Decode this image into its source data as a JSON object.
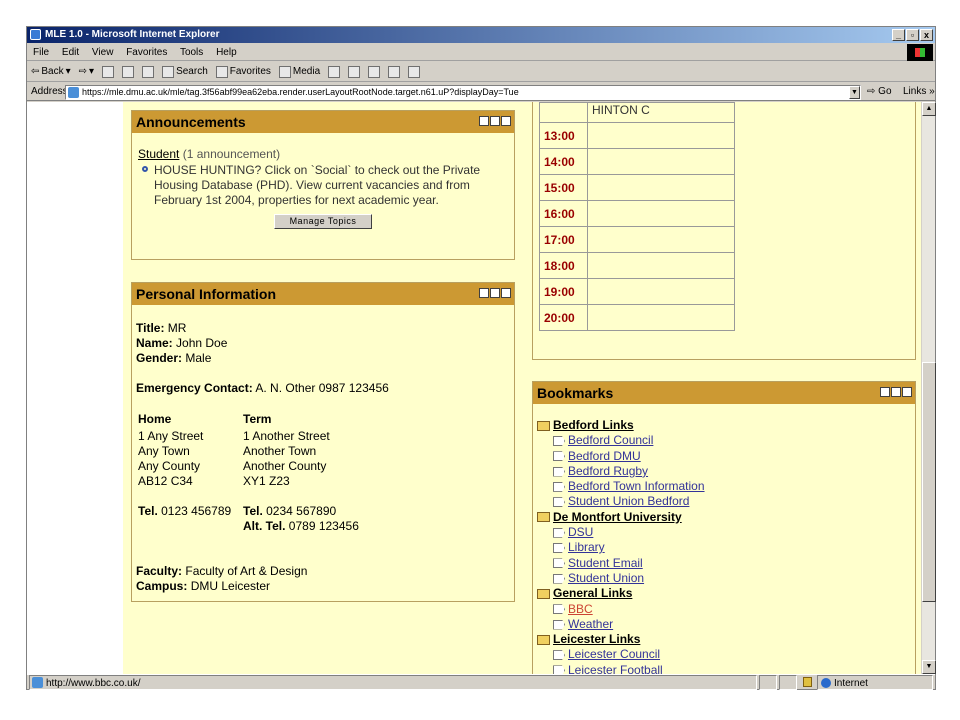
{
  "window": {
    "title": "MLE 1.0 - Microsoft Internet Explorer",
    "controls": [
      "_",
      "▫",
      "x"
    ]
  },
  "menu": [
    "File",
    "Edit",
    "View",
    "Favorites",
    "Tools",
    "Help"
  ],
  "toolbar": {
    "back": "Back",
    "search": "Search",
    "favorites": "Favorites",
    "media": "Media"
  },
  "address": {
    "label": "Address",
    "url": "https://mle.dmu.ac.uk/mle/tag.3f56abf99ea62eba.render.userLayoutRootNode.target.n61.uP?displayDay=Tue",
    "go": "Go",
    "links": "Links"
  },
  "announcements": {
    "title": "Announcements",
    "topic": "Student",
    "count": "(1 announcement)",
    "item": "HOUSE HUNTING? Click on `Social` to check out the Private Housing Database (PHD). View current vacancies and from February 1st 2004, properties for next academic year.",
    "manage_button": "Manage Topics"
  },
  "personal": {
    "title": "Personal Information",
    "title_label": "Title:",
    "title_value": "MR",
    "name_label": "Name:",
    "name_value": "John Doe",
    "gender_label": "Gender:",
    "gender_value": "Male",
    "emergency_label": "Emergency Contact:",
    "emergency_value": "A. N. Other 0987 123456",
    "home": {
      "heading": "Home",
      "line1": "1 Any Street",
      "line2": "Any Town",
      "line3": "Any County",
      "line4": "AB12 C34",
      "tel_label": "Tel.",
      "tel": "0123 456789"
    },
    "term": {
      "heading": "Term",
      "line1": "1 Another Street",
      "line2": "Another Town",
      "line3": "Another County",
      "line4": "XY1 Z23",
      "tel_label": "Tel.",
      "tel": "0234 567890",
      "alt_label": "Alt. Tel.",
      "alt_tel": "0789 123456"
    },
    "faculty_label": "Faculty:",
    "faculty_value": "Faculty of Art & Design",
    "campus_label": "Campus:",
    "campus_value": "DMU Leicester"
  },
  "timetable": {
    "top_entry": "HINTON C",
    "rows": [
      "13:00",
      "14:00",
      "15:00",
      "16:00",
      "17:00",
      "18:00",
      "19:00",
      "20:00"
    ]
  },
  "bookmarks": {
    "title": "Bookmarks",
    "groups": [
      {
        "folder": "Bedford Links",
        "links": [
          "Bedford Council",
          "Bedford DMU",
          "Bedford Rugby",
          "Bedford Town Information",
          "Student Union Bedford"
        ]
      },
      {
        "folder": "De Montfort University",
        "links": [
          "DSU",
          "Library",
          "Student Email",
          "Student Union"
        ]
      },
      {
        "folder": "General Links",
        "links": [
          "BBC",
          "Weather"
        ]
      },
      {
        "folder": "Leicester Links",
        "links": [
          "Leicester Council",
          "Leicester Football"
        ]
      }
    ]
  },
  "status": {
    "url": "http://www.bbc.co.uk/",
    "zone": "Internet"
  },
  "colors": {
    "panel_header": "#cc9933",
    "page_background": "#ffffcc",
    "time_text": "#990000",
    "link": "#333399",
    "visited_link": "#cc4433"
  }
}
